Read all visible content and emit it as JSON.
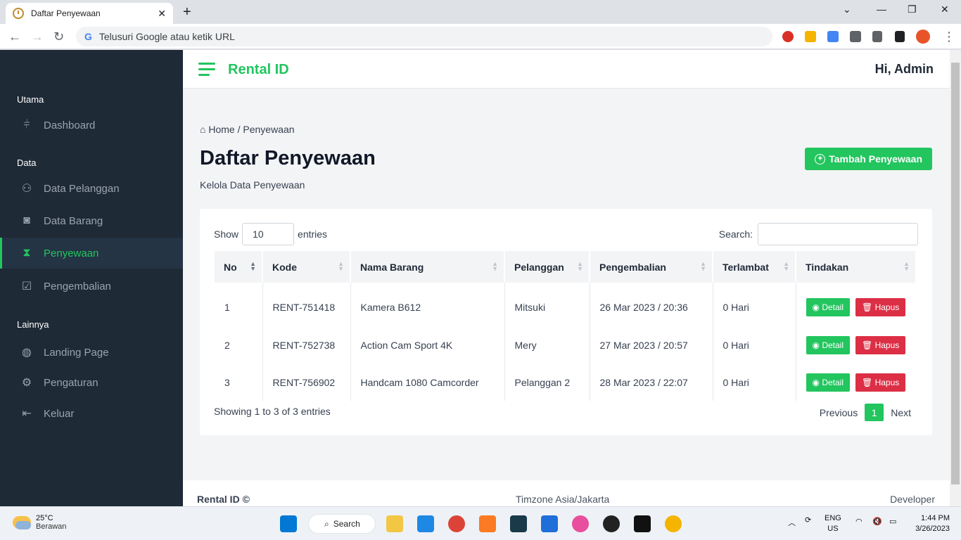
{
  "browser": {
    "tab_title": "Daftar Penyewaan",
    "tab_close": "✕",
    "new_tab": "+",
    "omnibox_placeholder": "Telusuri Google atau ketik URL"
  },
  "sidebar": {
    "sections": [
      {
        "label": "Utama"
      },
      {
        "label": "Data"
      },
      {
        "label": "Lainnya"
      }
    ],
    "items": [
      {
        "label": "Dashboard",
        "icon": "sliders-icon"
      },
      {
        "label": "Data Pelanggan",
        "icon": "users-icon"
      },
      {
        "label": "Data Barang",
        "icon": "camera-icon"
      },
      {
        "label": "Penyewaan",
        "icon": "hourglass-icon",
        "active": true
      },
      {
        "label": "Pengembalian",
        "icon": "check-square-icon"
      },
      {
        "label": "Landing Page",
        "icon": "globe-icon"
      },
      {
        "label": "Pengaturan",
        "icon": "gear-icon"
      },
      {
        "label": "Keluar",
        "icon": "logout-icon"
      }
    ]
  },
  "header": {
    "brand": "Rental ID",
    "greeting": "Hi, Admin"
  },
  "page": {
    "breadcrumb_home": "Home",
    "breadcrumb_sep": "/",
    "breadcrumb_current": "Penyewaan",
    "title": "Daftar Penyewaan",
    "subtitle": "Kelola Data Penyewaan",
    "add_button": "Tambah Penyewaan"
  },
  "table_controls": {
    "show_label": "Show",
    "length_value": "10",
    "entries_label": "entries",
    "search_label": "Search:"
  },
  "table": {
    "columns": [
      "No",
      "Kode",
      "Nama Barang",
      "Pelanggan",
      "Pengembalian",
      "Terlambat",
      "Tindakan"
    ],
    "rows": [
      {
        "no": "1",
        "kode": "RENT-751418",
        "barang": "Kamera B612",
        "pelanggan": "Mitsuki",
        "pengembalian": "26 Mar 2023 / 20:36",
        "terlambat": "0 Hari"
      },
      {
        "no": "2",
        "kode": "RENT-752738",
        "barang": "Action Cam Sport 4K",
        "pelanggan": "Mery",
        "pengembalian": "27 Mar 2023 / 20:57",
        "terlambat": "0 Hari"
      },
      {
        "no": "3",
        "kode": "RENT-756902",
        "barang": "Handcam 1080 Camcorder",
        "pelanggan": "Pelanggan 2",
        "pengembalian": "28 Mar 2023 / 22:07",
        "terlambat": "0 Hari"
      }
    ],
    "detail_label": "Detail",
    "delete_label": "Hapus"
  },
  "pagination": {
    "info": "Showing 1 to 3 of 3 entries",
    "previous": "Previous",
    "current": "1",
    "next": "Next"
  },
  "footer": {
    "left": "Rental ID ©",
    "center": "Timzone Asia/Jakarta",
    "right": "Developer"
  },
  "taskbar": {
    "temperature": "25°C",
    "weather": "Berawan",
    "search": "Search",
    "lang1": "ENG",
    "lang2": "US",
    "time": "1:44 PM",
    "date": "3/26/2023"
  },
  "colors": {
    "accent": "#22c55e",
    "sidebar_bg": "#1f2a37",
    "danger": "#dc2f45"
  }
}
